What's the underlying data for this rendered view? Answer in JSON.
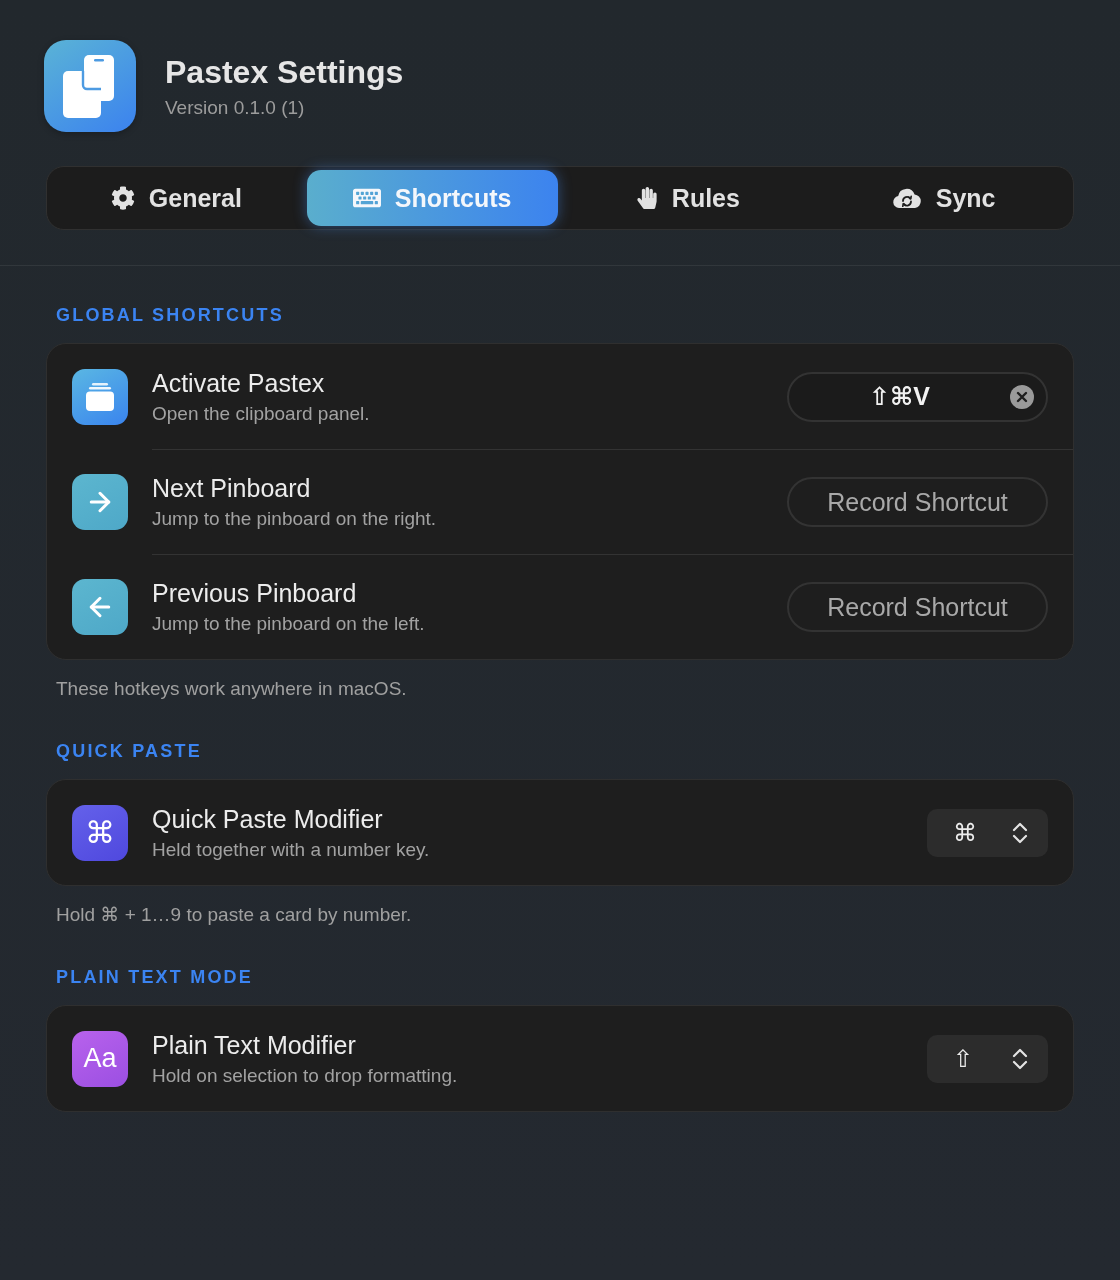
{
  "app": {
    "title": "Pastex Settings",
    "version": "Version 0.1.0 (1)"
  },
  "tabs": [
    {
      "label": "General",
      "selected": false
    },
    {
      "label": "Shortcuts",
      "selected": true
    },
    {
      "label": "Rules",
      "selected": false
    },
    {
      "label": "Sync",
      "selected": false
    }
  ],
  "sections": [
    {
      "title": "GLOBAL SHORTCUTS",
      "rows": [
        {
          "kind": "shortcut",
          "title": "Activate Pastex",
          "subtitle": "Open the clipboard panel.",
          "shortcut": "⇧⌘V"
        },
        {
          "kind": "record",
          "title": "Next Pinboard",
          "subtitle": "Jump to the pinboard on the right.",
          "button": "Record Shortcut"
        },
        {
          "kind": "record",
          "title": "Previous Pinboard",
          "subtitle": "Jump to the pinboard on the left.",
          "button": "Record Shortcut"
        }
      ],
      "note": "These hotkeys work anywhere in macOS."
    },
    {
      "title": "QUICK PASTE",
      "rows": [
        {
          "kind": "picker",
          "glyph": "⌘",
          "title": "Quick Paste Modifier",
          "subtitle": "Held together with a number key.",
          "value": "⌘"
        }
      ],
      "note": "Hold ⌘ + 1…9 to paste a card by number."
    },
    {
      "title": "PLAIN TEXT MODE",
      "rows": [
        {
          "kind": "picker",
          "glyph": "Aa",
          "title": "Plain Text Modifier",
          "subtitle": "Hold on selection to drop formatting.",
          "value": "⇧"
        }
      ]
    }
  ]
}
